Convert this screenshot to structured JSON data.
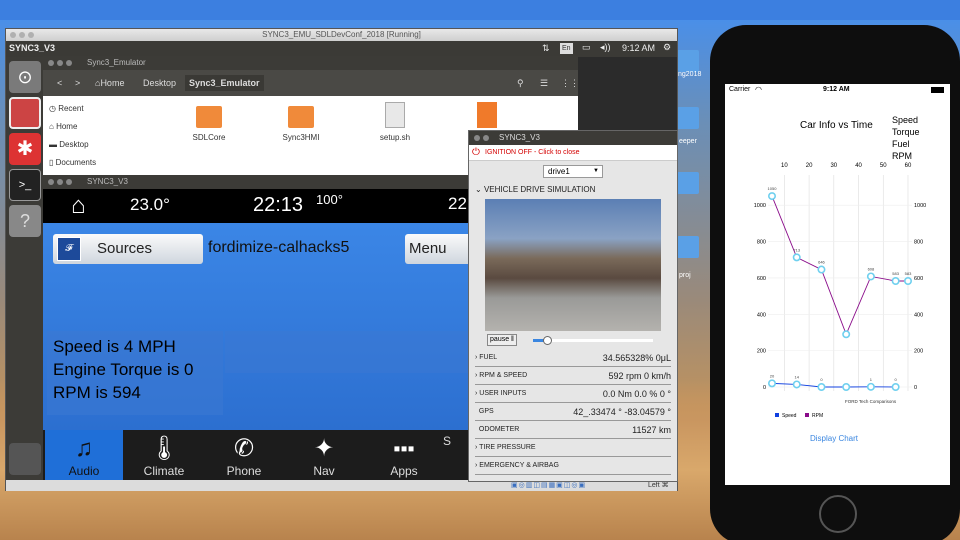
{
  "vbox": {
    "title": "SYNC3_EMU_SDLDevConf_2018 [Running]",
    "status_right": "Left ⌘"
  },
  "ubuntu": {
    "app_name": "SYNC3_V3",
    "lang": "En",
    "time": "9:12 AM"
  },
  "desktop": {
    "labels": [
      "ng2018",
      "eeper",
      "proj"
    ]
  },
  "nautilus": {
    "title": "Sync3_Emulator",
    "crumbs": [
      "Home",
      "Desktop",
      "Sync3_Emulator"
    ],
    "sidebar": [
      "Recent",
      "Home",
      "Desktop",
      "Documents"
    ],
    "files": [
      "SDLCore",
      "Sync3HMI",
      "setup.sh"
    ]
  },
  "sync": {
    "window_title": "SYNC3_V3",
    "temp_left": "23.0°",
    "time": "22:13",
    "temp_right": "100°",
    "right_partial": "22",
    "sources_label": "Sources",
    "app_title": "fordimize-calhacks5",
    "menu_label": "Menu",
    "info": [
      "Speed is 4 MPH",
      "Engine Torque is 0",
      "RPM is 594"
    ],
    "nav": [
      "Audio",
      "Climate",
      "Phone",
      "Nav",
      "Apps",
      "S"
    ]
  },
  "sim": {
    "title": "SYNC3_V3",
    "ignition": "IGNITION OFF - Click to close",
    "select": "drive1",
    "section": "VEHICLE DRIVE SIMULATION",
    "pause": "pause ‖",
    "rows": [
      {
        "label": "FUEL",
        "value": "34.565328%  0μL"
      },
      {
        "label": "RPM & SPEED",
        "value": "592 rpm   0 km/h"
      },
      {
        "label": "USER INPUTS",
        "value": "0.0 Nm   0.0 %   0 °"
      },
      {
        "label": "GPS",
        "value": "42_.33474 °      -83.04579 °"
      },
      {
        "label": "ODOMETER",
        "value": "11527  km"
      },
      {
        "label": "TIRE PRESSURE",
        "value": ""
      },
      {
        "label": "EMERGENCY & AIRBAG",
        "value": ""
      }
    ]
  },
  "phone": {
    "carrier": "Carrier",
    "time": "9:12 AM",
    "button": "Display Chart"
  },
  "chart_data": {
    "type": "line",
    "title": "Car Info vs Time",
    "legend_top": [
      "Speed",
      "Torque",
      "Fuel",
      "RPM"
    ],
    "x": [
      10,
      20,
      30,
      40,
      50,
      60
    ],
    "xlim": [
      5,
      60
    ],
    "ylim": [
      0,
      1100
    ],
    "y_ticks": [
      0,
      200,
      400,
      600,
      800,
      1000
    ],
    "series": [
      {
        "name": "Speed",
        "color": "#1040e0",
        "x": [
          5,
          15,
          25,
          35,
          45,
          55
        ],
        "values": [
          20,
          14,
          0,
          0,
          1,
          0
        ],
        "labels": [
          "20",
          "14",
          "0",
          "",
          "1",
          "0"
        ]
      },
      {
        "name": "RPM",
        "color": "#8a0c8a",
        "x": [
          5,
          15,
          25,
          35,
          45,
          55,
          60
        ],
        "values": [
          1050,
          713,
          646,
          290,
          608,
          583,
          583
        ],
        "labels": [
          "1050",
          "713",
          "646",
          "",
          "608",
          "583",
          "583"
        ]
      }
    ],
    "footnote": "FORD Tech Comparisons"
  }
}
